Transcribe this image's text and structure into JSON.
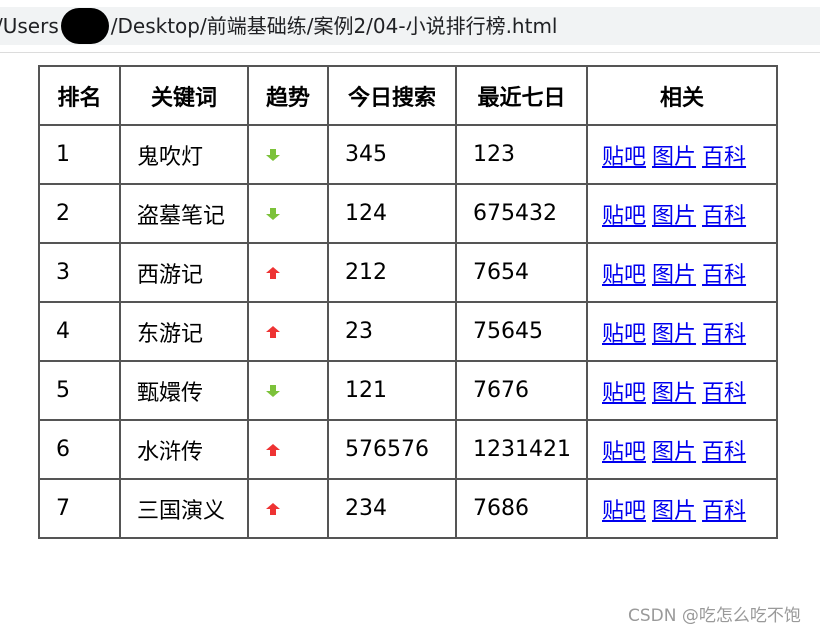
{
  "browser": {
    "url_prefix": "/Users",
    "url_suffix": "/Desktop/前端基础练/案例2/04-小说排行榜.html"
  },
  "table": {
    "headers": [
      "排名",
      "关键词",
      "趋势",
      "今日搜索",
      "最近七日",
      "相关"
    ],
    "rows": [
      {
        "rank": "1",
        "keyword": "鬼吹灯",
        "trend": "down",
        "today": "345",
        "week": "123"
      },
      {
        "rank": "2",
        "keyword": "盗墓笔记",
        "trend": "down",
        "today": "124",
        "week": "675432"
      },
      {
        "rank": "3",
        "keyword": "西游记",
        "trend": "up",
        "today": "212",
        "week": "7654"
      },
      {
        "rank": "4",
        "keyword": "东游记",
        "trend": "up",
        "today": "23",
        "week": "75645"
      },
      {
        "rank": "5",
        "keyword": "甄嬛传",
        "trend": "down",
        "today": "121",
        "week": "7676"
      },
      {
        "rank": "6",
        "keyword": "水浒传",
        "trend": "up",
        "today": "576576",
        "week": "1231421"
      },
      {
        "rank": "7",
        "keyword": "三国演义",
        "trend": "up",
        "today": "234",
        "week": "7686"
      }
    ],
    "links": [
      "贴吧",
      "图片",
      "百科"
    ]
  },
  "icons": {
    "up": {
      "name": "arrow-up-icon",
      "color": "#ee3333"
    },
    "down": {
      "name": "arrow-down-icon",
      "color": "#7cc23a"
    }
  },
  "watermark": "CSDN @吃怎么吃不饱"
}
